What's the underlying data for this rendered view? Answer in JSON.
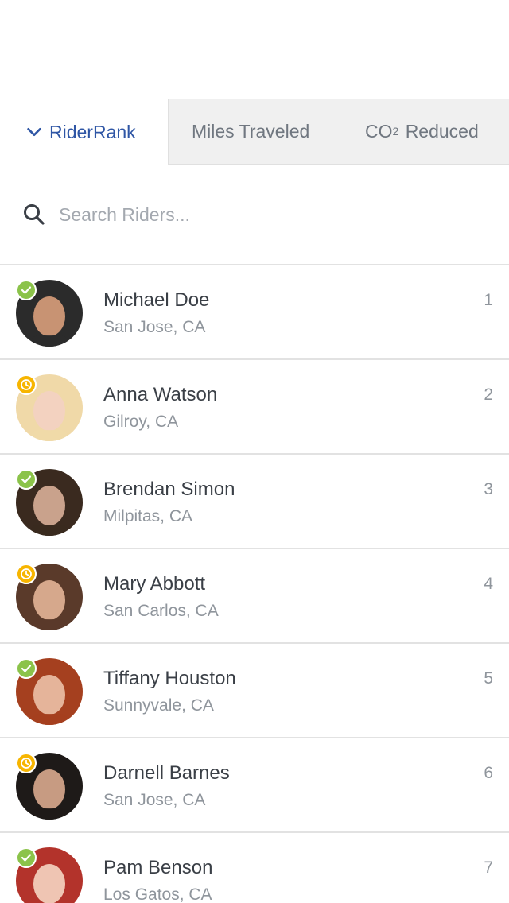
{
  "tabs": {
    "rider_rank": "RiderRank",
    "miles_traveled": "Miles Traveled",
    "co2_prefix": "CO",
    "co2_sub": "2",
    "co2_suffix": "Reduced"
  },
  "search": {
    "placeholder": "Search Riders..."
  },
  "riders": [
    {
      "name": "Michael Doe",
      "city": "San Jose, CA",
      "rank": "1",
      "status": "verified",
      "colors": [
        "#2b2b2b",
        "#c89373"
      ]
    },
    {
      "name": "Anna Watson",
      "city": "Gilroy, CA",
      "rank": "2",
      "status": "pending",
      "colors": [
        "#f0d9a8",
        "#f3d2c0"
      ]
    },
    {
      "name": "Brendan Simon",
      "city": "Milpitas, CA",
      "rank": "3",
      "status": "verified",
      "colors": [
        "#3a2a1f",
        "#c9a28c"
      ]
    },
    {
      "name": "Mary Abbott",
      "city": "San Carlos, CA",
      "rank": "4",
      "status": "pending",
      "colors": [
        "#5a3a2a",
        "#d6a88c"
      ]
    },
    {
      "name": "Tiffany Houston",
      "city": "Sunnyvale, CA",
      "rank": "5",
      "status": "verified",
      "colors": [
        "#a5401f",
        "#e5b49a"
      ]
    },
    {
      "name": "Darnell Barnes",
      "city": "San Jose, CA",
      "rank": "6",
      "status": "pending",
      "colors": [
        "#1e1a18",
        "#c79b82"
      ]
    },
    {
      "name": "Pam Benson",
      "city": "Los Gatos, CA",
      "rank": "7",
      "status": "verified",
      "colors": [
        "#b3332b",
        "#efc5b3"
      ]
    }
  ],
  "colors": {
    "accent": "#2f56a5",
    "verified": "#8bc34a",
    "pending": "#f7b500"
  }
}
